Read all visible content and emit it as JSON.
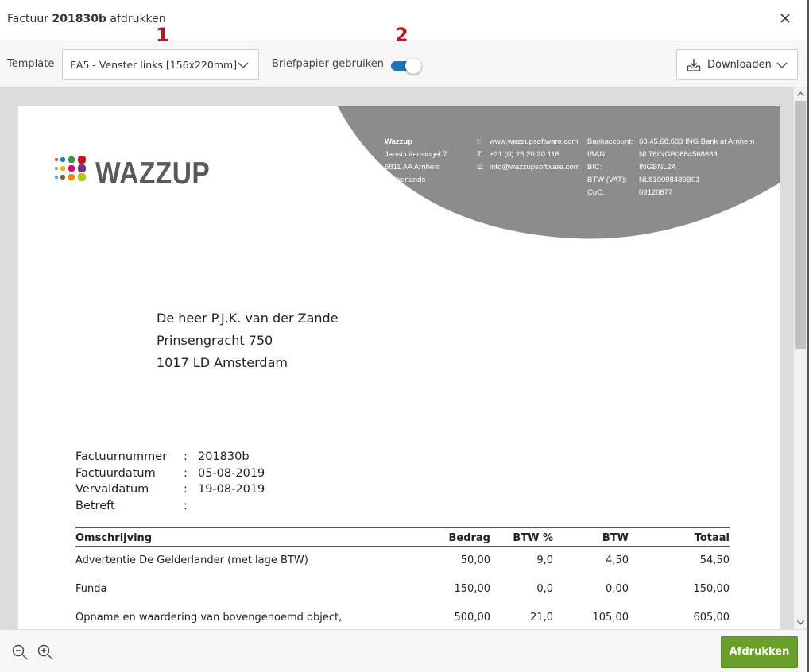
{
  "window": {
    "title_prefix": "Factuur",
    "title_number": "201830b",
    "title_suffix": "afdrukken"
  },
  "toolbar": {
    "template_label": "Template",
    "template_value": "EA5 - Venster links [156x220mm]",
    "briefpapier_label": "Briefpapier gebruiken",
    "briefpapier_enabled": true,
    "download_label": "Downloaden",
    "accent_color": "#1e73be"
  },
  "markers": [
    "1",
    "2"
  ],
  "document": {
    "company": {
      "logo_text": "WAZZUP",
      "logo_dot_colors": [
        "#e8433a",
        "#1d7cc3",
        "#2a9b47",
        "#c8102e",
        "#9aa0a6",
        "#f2b600",
        "#e3007b",
        "#7a2b8f",
        "#49a6df",
        "#7b5c3c",
        "#f08a00",
        "#b7c800"
      ],
      "name": "Wazzup",
      "address": [
        "Jansbuitensingel 7",
        "6811 AA Arnhem",
        "Netherlands"
      ],
      "contact_labels": [
        "I:",
        "T:",
        "E:"
      ],
      "contact_values": [
        "www.wazzupsoftware.com",
        "+31 (0) 26 20 20 116",
        "info@wazzupsoftware.com"
      ],
      "bank_labels": [
        "Bankaccount:",
        "IBAN:",
        "BIC:",
        "BTW (VAT):",
        "CoC:"
      ],
      "bank_values": [
        "68.45.68.683 ING Bank at Arnhem",
        "NL76INGB0684568683",
        "INGBNL2A",
        "NL810098489B01",
        "09120877"
      ],
      "header_color": "#8c8c8c"
    },
    "recipient": [
      "De heer P.J.K. van der Zande",
      "Prinsengracht 750",
      "1017 LD Amsterdam"
    ],
    "meta": [
      {
        "key": "Factuurnummer",
        "value": "201830b"
      },
      {
        "key": "Factuurdatum",
        "value": "05-08-2019"
      },
      {
        "key": "Vervaldatum",
        "value": "19-08-2019"
      },
      {
        "key": "Betreft",
        "value": ""
      }
    ],
    "meta_separator": ":",
    "table": {
      "headers": [
        "Omschrijving",
        "Bedrag",
        "BTW %",
        "BTW",
        "Totaal"
      ],
      "rows": [
        [
          "Advertentie De Gelderlander (met lage BTW)",
          "50,00",
          "9,0",
          "4,50",
          "54,50"
        ],
        [
          "Funda",
          "150,00",
          "0,0",
          "0,00",
          "150,00"
        ],
        [
          "Opname en waardering van bovengenoemd object,",
          "500,00",
          "21,0",
          "105,00",
          "605,00"
        ]
      ]
    }
  },
  "footer": {
    "print_label": "Afdrukken",
    "print_color": "#6a9f2a"
  }
}
